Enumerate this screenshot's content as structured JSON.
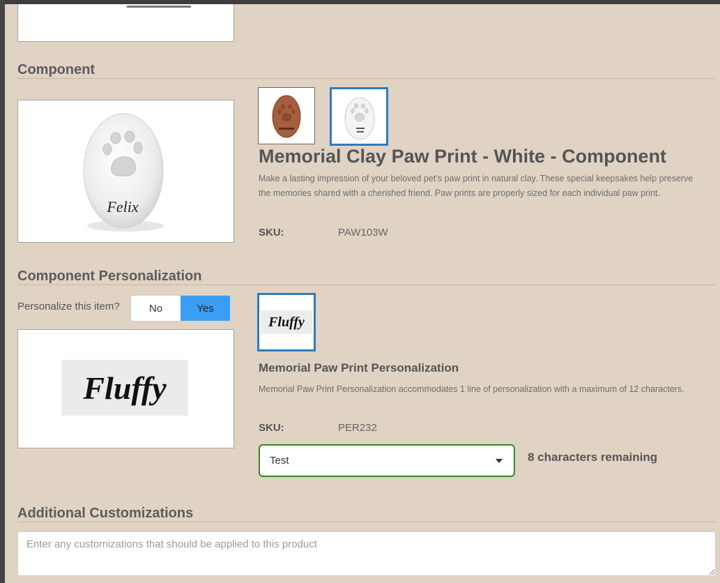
{
  "component_section": {
    "title": "Component",
    "product": {
      "title": "Memorial Clay Paw Print - White - Component",
      "description": "Make a lasting impression of your beloved pet’s paw print in natural clay. These special keepsakes help preserve the memories shared with a cherished friend. Paw prints are properly sized for each individual paw print.",
      "sku_label": "SKU:",
      "sku": "PAW103W",
      "preview_name": "Felix"
    },
    "thumbnails": [
      {
        "name": "terracotta-variant",
        "selected": false
      },
      {
        "name": "white-variant",
        "selected": true
      }
    ]
  },
  "personalization_section": {
    "title": "Component Personalization",
    "question": "Personalize this item?",
    "options": {
      "no": "No",
      "yes": "Yes"
    },
    "selected": "Yes",
    "preview_text": "Fluffy",
    "thumbnail_text": "Fluffy",
    "product": {
      "title": "Memorial Paw Print Personalization",
      "description": "Memorial Paw Print Personalization accommodates 1 line of personalization with a maximum of 12 characters.",
      "sku_label": "SKU:",
      "sku": "PER232"
    },
    "input_value": "Test",
    "remaining_text": "8 characters remaining"
  },
  "additional_section": {
    "title": "Additional Customizations",
    "placeholder": "Enter any customizations that should be applied to this product"
  },
  "colors": {
    "panel_bg": "#e0d3c4",
    "selected_border": "#2e7bbf",
    "toggle_active": "#3b9ef5",
    "input_focus_border": "#2e8b1e"
  }
}
